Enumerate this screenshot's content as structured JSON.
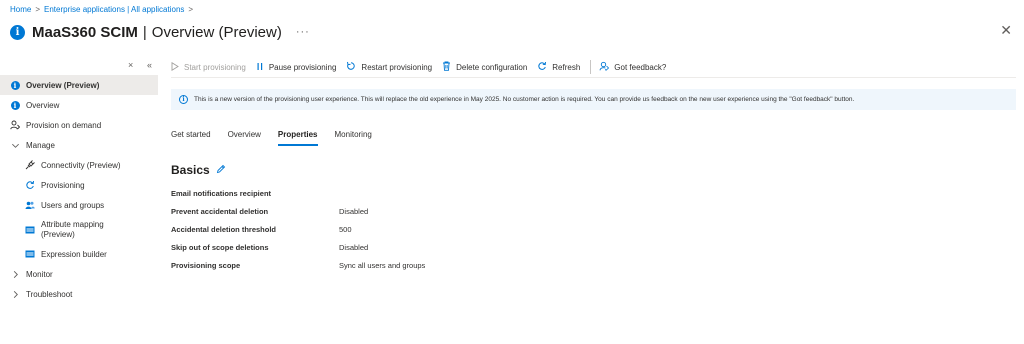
{
  "breadcrumb": {
    "items": [
      "Home",
      "Enterprise applications | All applications"
    ]
  },
  "header": {
    "app_name": "MaaS360 SCIM",
    "separator": "|",
    "page_name": "Overview (Preview)",
    "more": "···",
    "close": "✕"
  },
  "sidebar": {
    "close_tool": "×",
    "collapse_tool": "«",
    "items": [
      {
        "label": "Overview (Preview)",
        "icon": "info-icon"
      },
      {
        "label": "Overview",
        "icon": "info-icon"
      },
      {
        "label": "Provision on demand",
        "icon": "user-provision-icon"
      },
      {
        "label": "Manage",
        "icon": "chevron-down-icon"
      },
      {
        "label": "Connectivity (Preview)",
        "icon": "plug-icon"
      },
      {
        "label": "Provisioning",
        "icon": "sync-icon"
      },
      {
        "label": "Users and groups",
        "icon": "users-icon"
      },
      {
        "label": "Attribute mapping",
        "label2": "(Preview)",
        "icon": "table-icon"
      },
      {
        "label": "Expression builder",
        "icon": "table-icon"
      },
      {
        "label": "Monitor",
        "icon": "chevron-right-icon"
      },
      {
        "label": "Troubleshoot",
        "icon": "chevron-right-icon"
      }
    ]
  },
  "toolbar": {
    "start": "Start provisioning",
    "pause": "Pause provisioning",
    "restart": "Restart provisioning",
    "delete": "Delete configuration",
    "refresh": "Refresh",
    "feedback": "Got feedback?"
  },
  "banner": {
    "text": "This is a new version of the provisioning user experience. This will replace the old experience in May 2025. No customer action is required. You can provide us feedback on the new user experience using the \"Got feedback\" button."
  },
  "tabs": [
    {
      "label": "Get started",
      "active": false
    },
    {
      "label": "Overview",
      "active": false
    },
    {
      "label": "Properties",
      "active": true
    },
    {
      "label": "Monitoring",
      "active": false
    }
  ],
  "basics": {
    "title": "Basics",
    "rows": [
      {
        "label": "Email notifications recipient",
        "value": ""
      },
      {
        "label": "Prevent accidental deletion",
        "value": "Disabled"
      },
      {
        "label": "Accidental deletion threshold",
        "value": "500"
      },
      {
        "label": "Skip out of scope deletions",
        "value": "Disabled"
      },
      {
        "label": "Provisioning scope",
        "value": "Sync all users and groups"
      }
    ]
  },
  "colors": {
    "accent": "#0078d4",
    "banner_bg": "#eff6fc",
    "active_nav_bg": "#edebe9"
  }
}
